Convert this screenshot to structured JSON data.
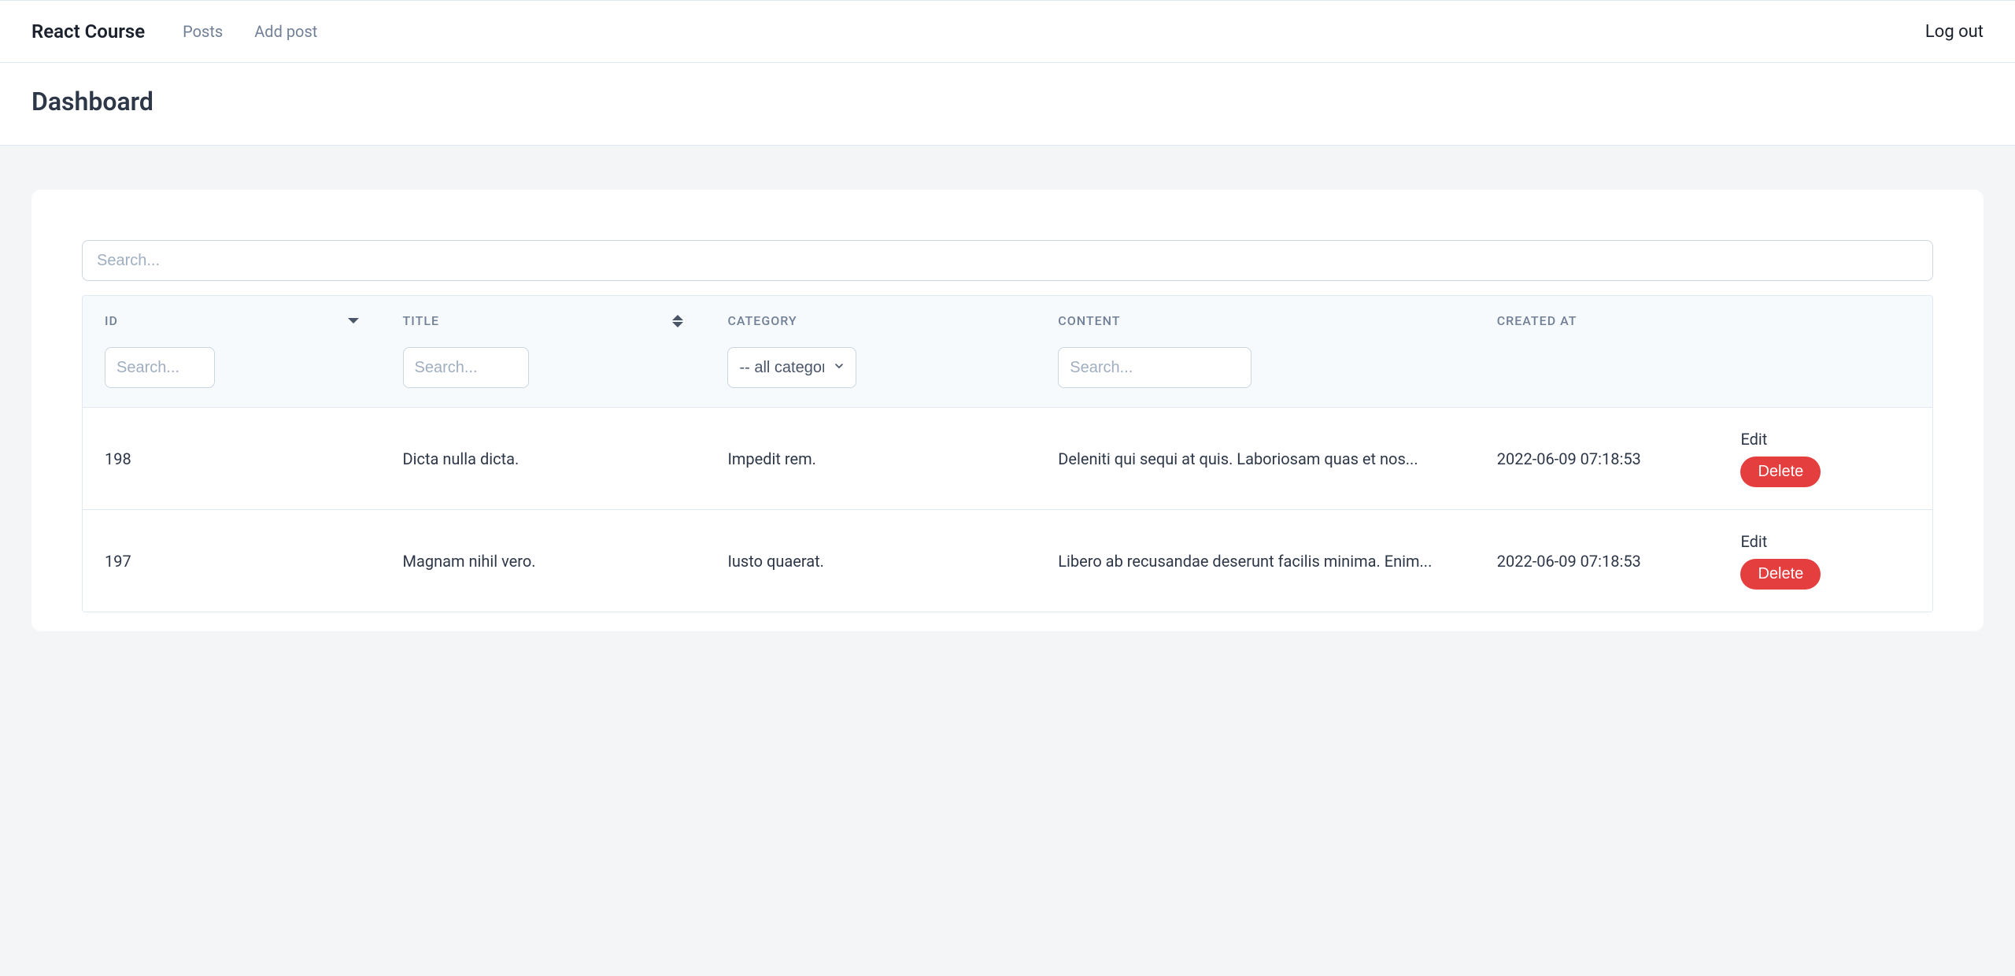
{
  "navbar": {
    "brand": "React Course",
    "links": [
      "Posts",
      "Add post"
    ],
    "logout": "Log out"
  },
  "page": {
    "title": "Dashboard"
  },
  "search": {
    "placeholder": "Search..."
  },
  "table": {
    "columns": {
      "id": "ID",
      "title": "TITLE",
      "category": "CATEGORY",
      "content": "CONTENT",
      "created_at": "CREATED AT"
    },
    "filters": {
      "id_placeholder": "Search...",
      "title_placeholder": "Search...",
      "category_selected": "-- all categories",
      "content_placeholder": "Search..."
    },
    "rows": [
      {
        "id": "198",
        "title": "Dicta nulla dicta.",
        "category": "Impedit rem.",
        "content": "Deleniti qui sequi at quis. Laboriosam quas et nos...",
        "created_at": "2022-06-09 07:18:53"
      },
      {
        "id": "197",
        "title": "Magnam nihil vero.",
        "category": "Iusto quaerat.",
        "content": "Libero ab recusandae deserunt facilis minima. Enim...",
        "created_at": "2022-06-09 07:18:53"
      }
    ],
    "actions": {
      "edit": "Edit",
      "delete": "Delete"
    }
  }
}
